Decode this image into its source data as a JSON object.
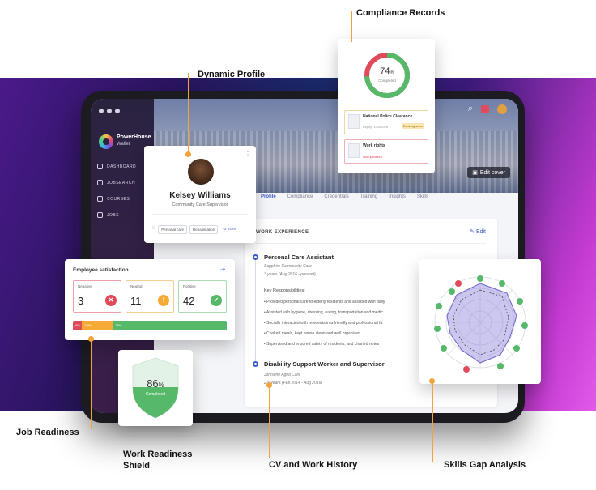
{
  "callouts": {
    "compliance_records": "Compliance Records",
    "dynamic_profile": "Dynamic Profile",
    "job_readiness": "Job Readiness",
    "work_readiness_shield_line1": "Work Readiness",
    "work_readiness_shield_line2": "Shield",
    "cv_work_history": "CV and Work History",
    "skills_gap_analysis": "Skills Gap Analysis"
  },
  "app": {
    "brand_name": "PowerHouse",
    "brand_sub": "Wallet",
    "nav": [
      {
        "label": "DASHBOARD",
        "icon": "dashboard-icon"
      },
      {
        "label": "JOBSEARCH",
        "icon": "briefcase-icon"
      },
      {
        "label": "COURSES",
        "icon": "book-icon"
      },
      {
        "label": "JOBS",
        "icon": "document-icon"
      }
    ],
    "edit_cover": "Edit cover",
    "tabs": [
      "Profile",
      "Compliance",
      "Credentials",
      "Training",
      "Insights",
      "Skills"
    ]
  },
  "profile": {
    "name": "Kelsey Williams",
    "role": "Community Care Supervisor",
    "chips": [
      "Personal care",
      "Rehabilitation"
    ],
    "more": "+2 more"
  },
  "work": {
    "title": "WORK EXPERIENCE",
    "edit_label": "Edit",
    "job1": {
      "title": "Personal Care Assistant",
      "company": "Sapphire Community Care",
      "dates": "3 years (Aug 2016 - present)"
    },
    "resp_title": "Key Responsibilities:",
    "responsibilities": [
      "• Provided personal care to elderly residents and assisted with daily",
      "• Assisted with hygiene, dressing, eating, transportation and medic",
      "• Socially interacted with residents in a friendly and professional fa",
      "• Cooked meals, kept house clean and well organized",
      "• Supervised and ensured safety of residents, and charted notes"
    ],
    "job2": {
      "title": "Disability Support Worker and Supervisor",
      "company": "Johnsine Aged Care",
      "dates": "2.5 years (Feb 2014 - Aug 2016)"
    }
  },
  "compliance": {
    "percent": "74",
    "percent_sign": "%",
    "completed": "Completed",
    "percent_value": 0.74,
    "records": [
      {
        "title": "National Police Clearance",
        "expiry": "Expiry: 12/3/2026",
        "badge": "Expiring soon"
      },
      {
        "title": "Work rights",
        "status": "Not uploaded"
      }
    ]
  },
  "satisfaction": {
    "title": "Employee satisfaction",
    "negative_label": "Negative",
    "negative_value": "3",
    "neutral_label": "Neutral",
    "neutral_value": "11",
    "positive_label": "Positive",
    "positive_value": "42",
    "bar": [
      {
        "label": "6%",
        "fraction": 0.06,
        "color": "#e04b5b"
      },
      {
        "label": "20%",
        "fraction": 0.2,
        "color": "#f5a937"
      },
      {
        "label": "75%",
        "fraction": 0.74,
        "color": "#56b96a"
      }
    ]
  },
  "shield": {
    "percent": "86",
    "percent_sign": "%",
    "completed": "Completed"
  },
  "colors": {
    "accent": "#3a5bc7",
    "orange": "#f2a33a",
    "green": "#56b96a",
    "red": "#e04b5b",
    "yellow": "#f5a937"
  }
}
